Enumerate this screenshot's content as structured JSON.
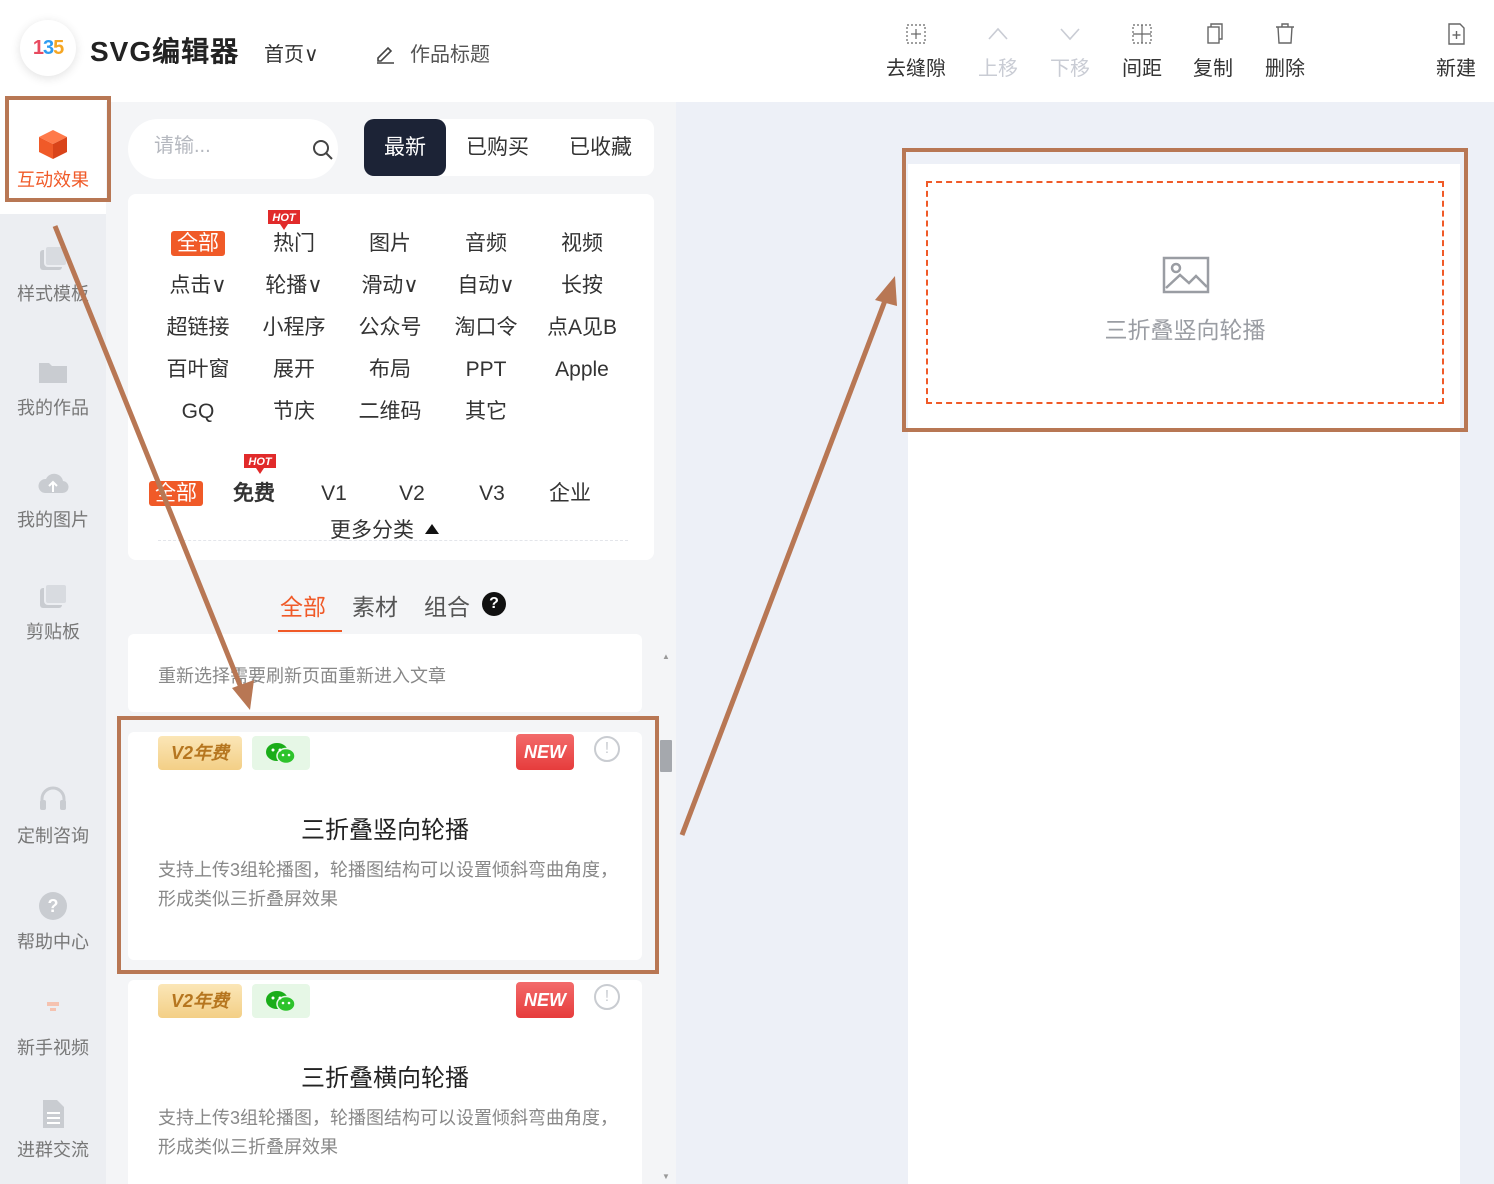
{
  "header": {
    "app_title": "SVG编辑器",
    "logo_text": [
      "1",
      "3",
      "5"
    ],
    "home_menu": "首页∨",
    "work_title": "作品标题",
    "tools": [
      {
        "label": "去缝隙",
        "icon": "remove-gap-icon",
        "enabled": true
      },
      {
        "label": "上移",
        "icon": "chevron-up-icon",
        "enabled": false
      },
      {
        "label": "下移",
        "icon": "chevron-down-icon",
        "enabled": false
      },
      {
        "label": "间距",
        "icon": "spacing-icon",
        "enabled": true
      },
      {
        "label": "复制",
        "icon": "copy-icon",
        "enabled": true
      },
      {
        "label": "删除",
        "icon": "trash-icon",
        "enabled": true
      },
      {
        "label": "新建",
        "icon": "new-file-icon",
        "enabled": true
      }
    ]
  },
  "leftnav": {
    "items": [
      {
        "label": "互动效果",
        "icon": "cube-icon",
        "active": true
      },
      {
        "label": "样式模板",
        "icon": "template-icon"
      },
      {
        "label": "我的作品",
        "icon": "folder-icon"
      },
      {
        "label": "我的图片",
        "icon": "cloud-upload-icon"
      },
      {
        "label": "剪贴板",
        "icon": "clipboard-icon"
      },
      {
        "label": "定制咨询",
        "icon": "headset-icon"
      },
      {
        "label": "帮助中心",
        "icon": "help-icon"
      },
      {
        "label": "新手视频",
        "icon": "video-icon"
      },
      {
        "label": "进群交流",
        "icon": "document-icon"
      }
    ]
  },
  "panel": {
    "search": {
      "placeholder": "请输..."
    },
    "filter_tabs": [
      {
        "label": "最新",
        "active": true
      },
      {
        "label": "已购买"
      },
      {
        "label": "已收藏"
      }
    ],
    "categories": [
      {
        "label": "全部",
        "active": true
      },
      {
        "label": "热门",
        "hot": true
      },
      {
        "label": "图片"
      },
      {
        "label": "音频"
      },
      {
        "label": "视频"
      },
      {
        "label": "点击∨"
      },
      {
        "label": "轮播∨"
      },
      {
        "label": "滑动∨"
      },
      {
        "label": "自动∨"
      },
      {
        "label": "长按"
      },
      {
        "label": "超链接"
      },
      {
        "label": "小程序"
      },
      {
        "label": "公众号"
      },
      {
        "label": "淘口令"
      },
      {
        "label": "点A见B"
      },
      {
        "label": "百叶窗"
      },
      {
        "label": "展开"
      },
      {
        "label": "布局"
      },
      {
        "label": "PPT"
      },
      {
        "label": "Apple"
      },
      {
        "label": "GQ"
      },
      {
        "label": "节庆"
      },
      {
        "label": "二维码"
      },
      {
        "label": "其它"
      }
    ],
    "hot_label": "HOT",
    "tiers": [
      {
        "label": "全部",
        "active": true
      },
      {
        "label": "免费",
        "hot": true
      },
      {
        "label": "V1"
      },
      {
        "label": "V2"
      },
      {
        "label": "V3"
      },
      {
        "label": "企业"
      }
    ],
    "more_categories": "更多分类",
    "sub_tabs": [
      {
        "label": "全部",
        "active": true
      },
      {
        "label": "素材"
      },
      {
        "label": "组合"
      }
    ],
    "help_mark": "?",
    "partial_card_text": "重新选择需要刷新页面重新进入文章",
    "cards": [
      {
        "badge_tier": "V2年费",
        "badge_new": "NEW",
        "info_mark": "!",
        "title": "三折叠竖向轮播",
        "desc": "支持上传3组轮播图，轮播图结构可以设置倾斜弯曲角度，形成类似三折叠屏效果"
      },
      {
        "badge_tier": "V2年费",
        "badge_new": "NEW",
        "info_mark": "!",
        "title": "三折叠横向轮播",
        "desc": "支持上传3组轮播图，轮播图结构可以设置倾斜弯曲角度，形成类似三折叠屏效果"
      }
    ]
  },
  "canvas": {
    "placeholder_label": "三折叠竖向轮播"
  },
  "colors": {
    "accent": "#f05a28",
    "annotation": "#b87754",
    "dark_tab": "#1c2336",
    "canvas_bg": "#edf0f7",
    "nav_bg": "#eceef2"
  }
}
